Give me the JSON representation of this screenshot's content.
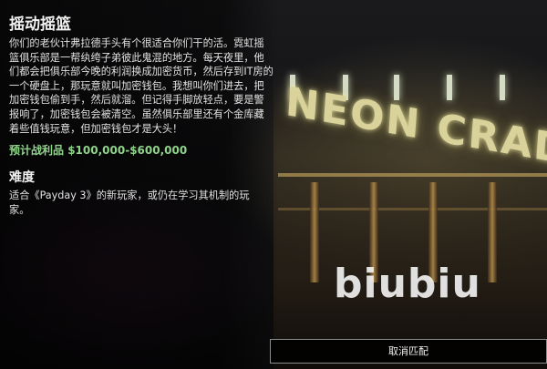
{
  "heist": {
    "title": "摇动摇篮",
    "description": "你们的老伙计弗拉德手头有个很适合你们干的活。霓虹摇篮俱乐部是一帮纨绔子弟彼此鬼混的地方。每天夜里，他们都会把俱乐部今晚的利润换成加密货币，然后存到IT房的一个硬盘上，那玩意就叫加密钱包。我想叫你们进去，把加密钱包偷到手，然后就溜。但记得手脚放轻点，要是警报响了，加密钱包会被清空。虽然俱乐部里还有个金库藏着些值钱玩意，但加密钱包才是大头！",
    "payout_label": "预计战利品",
    "payout_value": "$100,000-$600,000"
  },
  "difficulty": {
    "title": "难度",
    "description": "适合《Payday 3》的新玩家，或仍在学习其机制的玩家。"
  },
  "scene": {
    "sign_text": "NEON CRAD"
  },
  "watermark": "biubiu",
  "buttons": {
    "cancel_match": "取消匹配"
  },
  "colors": {
    "payout": "#8fd48a",
    "sign_glow": "#d9d29a"
  }
}
